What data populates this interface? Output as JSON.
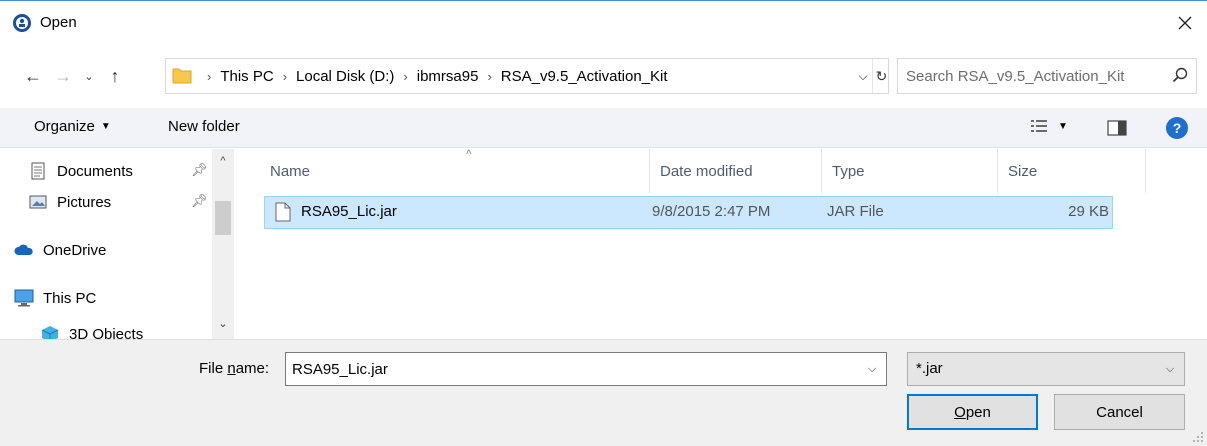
{
  "window": {
    "title": "Open"
  },
  "address": {
    "crumbs": [
      "This PC",
      "Local Disk (D:)",
      "ibmrsa95",
      "RSA_v9.5_Activation_Kit"
    ]
  },
  "search": {
    "placeholder": "Search RSA_v9.5_Activation_Kit"
  },
  "toolbar": {
    "organize_label": "Organize",
    "new_folder_label": "New folder",
    "help_label": "?"
  },
  "navpane": {
    "items": [
      {
        "label": "Documents",
        "icon": "documents-icon",
        "pinned": true
      },
      {
        "label": "Pictures",
        "icon": "pictures-icon",
        "pinned": true
      },
      {
        "label": "OneDrive",
        "icon": "onedrive-icon",
        "pinned": false
      },
      {
        "label": "This PC",
        "icon": "this-pc-icon",
        "pinned": false
      },
      {
        "label": "3D Objects",
        "icon": "3d-objects-icon",
        "pinned": false
      }
    ]
  },
  "columns": {
    "name": "Name",
    "date": "Date modified",
    "type": "Type",
    "size": "Size"
  },
  "files": [
    {
      "name": "RSA95_Lic.jar",
      "date": "9/8/2015 2:47 PM",
      "type": "JAR File",
      "size": "29 KB",
      "selected": true
    }
  ],
  "bottom": {
    "filename_label_pre": "File ",
    "filename_label_accel": "n",
    "filename_label_post": "ame:",
    "filename_value": "RSA95_Lic.jar",
    "filter_value": "*.jar",
    "open_label_accel": "O",
    "open_label_rest": "pen",
    "cancel_label": "Cancel"
  },
  "colors": {
    "selection_bg": "#cce8ff",
    "selection_border": "#99d1ff",
    "accent": "#0078d7"
  }
}
